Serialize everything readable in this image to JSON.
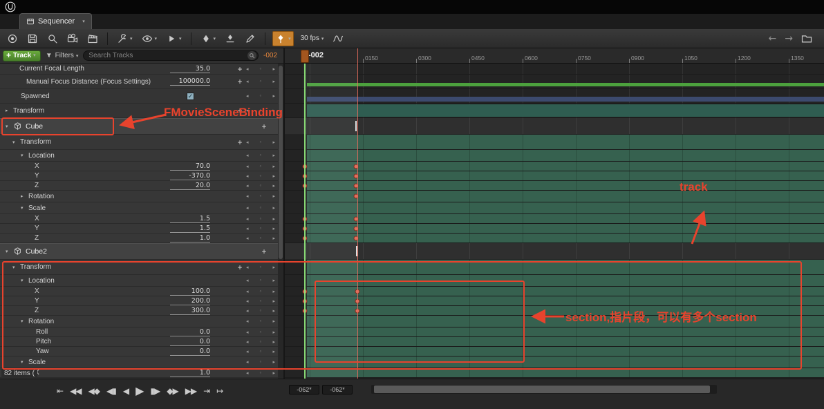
{
  "titlebar": {
    "tab": "Sequencer"
  },
  "toolbar": {
    "buttons": [
      {
        "name": "sequence-picker-button",
        "icon": "circle"
      },
      {
        "name": "save-button",
        "icon": "save"
      },
      {
        "name": "find-in-content-browser-button",
        "icon": "magnifier"
      },
      {
        "name": "create-camera-button",
        "icon": "camera"
      },
      {
        "name": "render-movie-button",
        "icon": "clapper"
      },
      {
        "name": "separator"
      },
      {
        "name": "actions-menu",
        "icon": "wrench",
        "dropdown": true
      },
      {
        "name": "view-options-menu",
        "icon": "eye",
        "dropdown": true
      },
      {
        "name": "playback-options-menu",
        "icon": "play",
        "dropdown": true
      },
      {
        "name": "separator"
      },
      {
        "name": "keyframe-options-menu",
        "icon": "diamond",
        "dropdown": true
      },
      {
        "name": "auto-key-button",
        "icon": "diamondbar"
      },
      {
        "name": "edit-tool-button",
        "icon": "pen"
      },
      {
        "name": "separator"
      },
      {
        "name": "key-all-enabled-button",
        "icon": "keywhite",
        "dropdown": true,
        "active": true
      },
      {
        "name": "fps-menu",
        "label": "30 fps",
        "dropdown": true
      },
      {
        "name": "curve-editor-button",
        "icon": "curve"
      }
    ],
    "nav_back": "←",
    "nav_forward": "→"
  },
  "track_header": {
    "track_button": "Track",
    "filters": "Filters",
    "search_placeholder": "Search Tracks",
    "time_field": "-002"
  },
  "timeline": {
    "current_time": "-002",
    "ruler_ticks": [
      "0150",
      "0300",
      "0450",
      "0600",
      "0750",
      "0900",
      "1050",
      "1200",
      "1350"
    ]
  },
  "outliner": {
    "items_count": "82 items (",
    "rows": [
      {
        "label": "Current Focal Length",
        "value": "35.0",
        "type": "top",
        "indent": 28,
        "plus": true,
        "keynav": true,
        "tl": "none",
        "clip": true
      },
      {
        "label": "Manual Focus Distance (Focus Settings)",
        "value": "100000.0",
        "type": "top",
        "indent": 38,
        "plus": true,
        "keynav": true,
        "tl": "greenbar"
      },
      {
        "label": "Spawned",
        "type": "top",
        "indent": 30,
        "checkbox": true,
        "keynav": true,
        "tl": "navybar"
      },
      {
        "label": "Transform",
        "type": "top",
        "indent": 19,
        "expander": "closed",
        "plus": true,
        "keynav": true,
        "tl": "tealbar"
      },
      {
        "label": "Cube",
        "type": "object",
        "indent": 19,
        "icon": "cube",
        "expander": "open",
        "plus": true,
        "tl": "object",
        "tick": 103
      },
      {
        "label": "Transform",
        "type": "transform",
        "indent": 29,
        "expander": "open",
        "plus": true,
        "keynav": true,
        "tl": "teal"
      },
      {
        "label": "Location",
        "type": "category",
        "indent": 41,
        "expander": "open",
        "keynav": true,
        "tl": "teal"
      },
      {
        "label": "X",
        "value": "70.0",
        "type": "property",
        "indent": 50,
        "keynav": true,
        "tl": "teal",
        "keys": [
          29,
          103
        ]
      },
      {
        "label": "Y",
        "value": "-370.0",
        "type": "property",
        "indent": 50,
        "keynav": true,
        "tl": "teal",
        "keys": [
          29,
          103
        ]
      },
      {
        "label": "Z",
        "value": "20.0",
        "type": "property",
        "indent": 50,
        "keynav": true,
        "tl": "teal",
        "keys": [
          29,
          103
        ]
      },
      {
        "label": "Rotation",
        "type": "category",
        "indent": 41,
        "expander": "closed",
        "keynav": true,
        "tl": "teal",
        "keys": [
          103
        ]
      },
      {
        "label": "Scale",
        "type": "category",
        "indent": 41,
        "expander": "open",
        "keynav": true,
        "tl": "teal"
      },
      {
        "label": "X",
        "value": "1.5",
        "type": "property",
        "indent": 50,
        "keynav": true,
        "tl": "teal",
        "keys": [
          29,
          103
        ]
      },
      {
        "label": "Y",
        "value": "1.5",
        "type": "property",
        "indent": 50,
        "keynav": true,
        "tl": "teal",
        "keys": [
          29,
          103
        ]
      },
      {
        "label": "Z",
        "value": "1.0",
        "type": "property",
        "indent": 50,
        "keynav": true,
        "tl": "teal",
        "keys": [
          29,
          103
        ]
      },
      {
        "label": "Cube2",
        "type": "object",
        "indent": 19,
        "icon": "cube",
        "expander": "open",
        "plus": true,
        "tl": "object",
        "tick": 104
      },
      {
        "label": "Transform",
        "type": "transform",
        "indent": 29,
        "expander": "open",
        "plus": true,
        "keynav": true,
        "tl": "teal"
      },
      {
        "label": "Location",
        "type": "category",
        "indent": 41,
        "expander": "open",
        "keynav": true,
        "tl": "teal"
      },
      {
        "label": "X",
        "value": "100.0",
        "type": "property",
        "indent": 50,
        "keynav": true,
        "tl": "teal",
        "keys": [
          29,
          105
        ]
      },
      {
        "label": "Y",
        "value": "200.0",
        "type": "property",
        "indent": 50,
        "keynav": true,
        "tl": "teal",
        "keys": [
          29,
          105
        ]
      },
      {
        "label": "Z",
        "value": "300.0",
        "type": "property",
        "indent": 50,
        "keynav": true,
        "tl": "teal",
        "keys": [
          29,
          105
        ]
      },
      {
        "label": "Rotation",
        "type": "category",
        "indent": 41,
        "expander": "open",
        "keynav": true,
        "tl": "teal"
      },
      {
        "label": "Roll",
        "value": "0.0",
        "type": "property",
        "indent": 52,
        "keynav": true,
        "tl": "teal"
      },
      {
        "label": "Pitch",
        "value": "0.0",
        "type": "property",
        "indent": 52,
        "keynav": true,
        "tl": "teal"
      },
      {
        "label": "Yaw",
        "value": "0.0",
        "type": "property",
        "indent": 52,
        "keynav": true,
        "tl": "teal"
      },
      {
        "label": "Scale",
        "type": "category",
        "indent": 41,
        "expander": "open",
        "keynav": true,
        "tl": "teal"
      },
      {
        "label": "X",
        "value": "1.0",
        "type": "property",
        "indent": 50,
        "keynav": true,
        "tl": "teal"
      }
    ]
  },
  "transport": {
    "buttons": [
      {
        "name": "jump-to-start-button",
        "glyph": "⇤"
      },
      {
        "name": "rewind-button",
        "glyph": "◀◀"
      },
      {
        "name": "previous-key-button",
        "glyph": "◀◆"
      },
      {
        "name": "step-back-button",
        "glyph": "◀▮"
      },
      {
        "name": "play-reverse-button",
        "glyph": "◀"
      },
      {
        "name": "play-button",
        "glyph": "▶",
        "big": true
      },
      {
        "name": "step-forward-button",
        "glyph": "▮▶"
      },
      {
        "name": "next-key-button",
        "glyph": "◆▶"
      },
      {
        "name": "fast-forward-button",
        "glyph": "▶▶"
      },
      {
        "name": "jump-to-end-button",
        "glyph": "⇥"
      },
      {
        "name": "loop-toggle-button",
        "glyph": "↦"
      }
    ]
  },
  "status": {
    "range_start": "-062*",
    "range_end": "-062*"
  },
  "annotations": {
    "binding": "FMovieSceneBinding",
    "track": "track",
    "section": "section,指片段，可以有多个section",
    "color": "#e8432d"
  },
  "colors": {
    "annotation": "#e8432d",
    "accent_orange": "#c9822e",
    "section_teal": "#36614f",
    "playhead_green": "#8ce178",
    "track_button_green": "#5ea23a",
    "header_time_orange": "#e8873c",
    "key_dot": "#e0705e"
  }
}
